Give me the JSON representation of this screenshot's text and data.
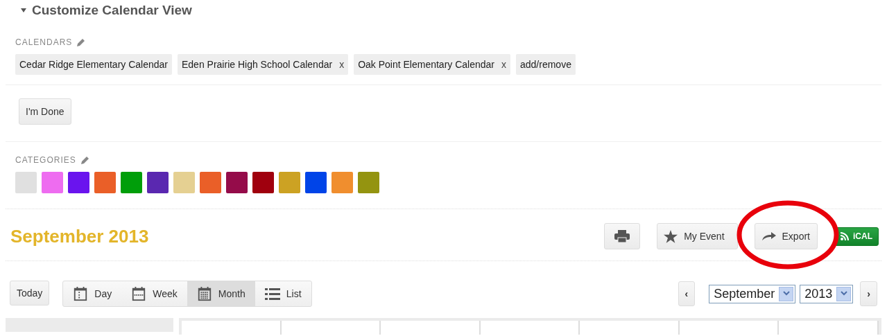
{
  "section_title": "Customize Calendar View",
  "calendars": {
    "label": "CALENDARS",
    "items": [
      {
        "name": "Cedar Ridge Elementary Calendar",
        "removable": false
      },
      {
        "name": "Eden Prairie High School Calendar",
        "removable": true,
        "remove": "x"
      },
      {
        "name": "Oak Point Elementary Calendar",
        "removable": true,
        "remove": "x"
      }
    ],
    "add_remove": "add/remove"
  },
  "done_button": "I'm Done",
  "categories": {
    "label": "CATEGORIES",
    "swatches": [
      {
        "color": "#e0e0e0"
      },
      {
        "color": "#ee6cf0"
      },
      {
        "color": "#6a14ee"
      },
      {
        "color": "#ea5f28"
      },
      {
        "color": "#009e0a"
      },
      {
        "color": "#5a28b0"
      },
      {
        "color": "#e5d092"
      },
      {
        "color": "#ea5f28"
      },
      {
        "color": "#950c4a"
      },
      {
        "color": "#a0000e"
      },
      {
        "color": "#cca223"
      },
      {
        "color": "#0044e8"
      },
      {
        "color": "#f08e2e"
      },
      {
        "color": "#949410"
      }
    ]
  },
  "month_title": "September 2013",
  "actions": [
    {
      "kind": "print"
    },
    {
      "kind": "star",
      "label": "My Event"
    },
    {
      "kind": "export",
      "label": "Export"
    },
    {
      "kind": "feed",
      "label": "iCAL"
    }
  ],
  "today_button": "Today",
  "views": [
    {
      "kind": "day",
      "label": "Day",
      "selected": false
    },
    {
      "kind": "week",
      "label": "Week",
      "selected": false
    },
    {
      "kind": "month",
      "label": "Month",
      "selected": true
    },
    {
      "kind": "list",
      "label": "List",
      "selected": false
    }
  ],
  "prev": "‹",
  "next": "›",
  "month_select": "September",
  "year_select": "2013"
}
